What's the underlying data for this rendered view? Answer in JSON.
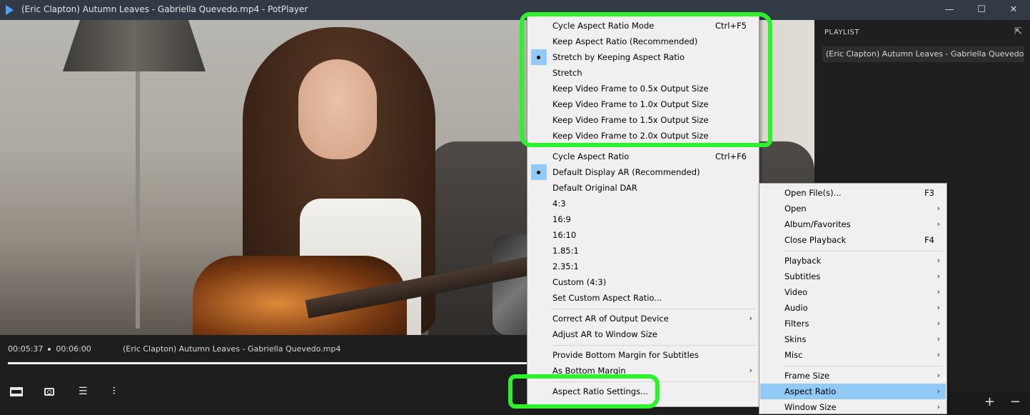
{
  "window": {
    "title": "(Eric Clapton) Autumn Leaves - Gabriella Quevedo.mp4 - PotPlayer",
    "minimize": "—",
    "maximize": "☐",
    "close": "✕"
  },
  "controls": {
    "current_time": "00:05:37",
    "total_time": "00:06:00",
    "file_name": "(Eric Clapton) Autumn Leaves - Gabriella Quevedo.mp4",
    "progress": 0.936
  },
  "playlist": {
    "header": "PLAYLIST",
    "expand_glyph": "⇱",
    "items": [
      "(Eric Clapton) Autumn Leaves - Gabriella Quevedo...."
    ],
    "add": "+",
    "remove": "−"
  },
  "aspect_menu": {
    "items": [
      {
        "label": "Cycle Aspect Ratio Mode",
        "shortcut": "Ctrl+F5"
      },
      {
        "label": "Keep Aspect Ratio (Recommended)"
      },
      {
        "label": "Stretch by Keeping Aspect Ratio",
        "checked": true
      },
      {
        "label": "Stretch"
      },
      {
        "label": "Keep Video Frame to 0.5x Output Size"
      },
      {
        "label": "Keep Video Frame to 1.0x Output Size"
      },
      {
        "label": "Keep Video Frame to 1.5x Output Size"
      },
      {
        "label": "Keep Video Frame to 2.0x Output Size"
      },
      {
        "label": "Cycle Aspect Ratio",
        "shortcut": "Ctrl+F6"
      },
      {
        "label": "Default Display AR (Recommended)",
        "checked": true
      },
      {
        "label": "Default Original DAR"
      },
      {
        "label": "4:3"
      },
      {
        "label": "16:9"
      },
      {
        "label": "16:10"
      },
      {
        "label": "1.85:1"
      },
      {
        "label": "2.35:1"
      },
      {
        "label": "Custom (4:3)"
      },
      {
        "label": "Set Custom Aspect Ratio..."
      },
      {
        "label": "Correct AR of Output Device",
        "submenu": true
      },
      {
        "label": "Adjust AR to Window Size"
      },
      {
        "label": "Provide Bottom Margin for Subtitles"
      },
      {
        "label": "As Bottom Margin",
        "submenu": true
      },
      {
        "label": "Aspect Ratio Settings..."
      }
    ]
  },
  "main_menu": {
    "items": [
      {
        "label": "Open File(s)...",
        "shortcut": "F3"
      },
      {
        "label": "Open",
        "submenu": true
      },
      {
        "label": "Album/Favorites",
        "submenu": true
      },
      {
        "label": "Close Playback",
        "shortcut": "F4"
      },
      {
        "label": "Playback",
        "submenu": true
      },
      {
        "label": "Subtitles",
        "submenu": true
      },
      {
        "label": "Video",
        "submenu": true
      },
      {
        "label": "Audio",
        "submenu": true
      },
      {
        "label": "Filters",
        "submenu": true
      },
      {
        "label": "Skins",
        "submenu": true
      },
      {
        "label": "Misc",
        "submenu": true
      },
      {
        "label": "Frame Size",
        "submenu": true
      },
      {
        "label": "Aspect Ratio",
        "submenu": true,
        "highlighted": true
      },
      {
        "label": "Window Size",
        "submenu": true
      }
    ]
  },
  "colors": {
    "annotation": "#2df12d",
    "menu_highlight": "#91c9f7",
    "title_bar": "#323a46"
  }
}
